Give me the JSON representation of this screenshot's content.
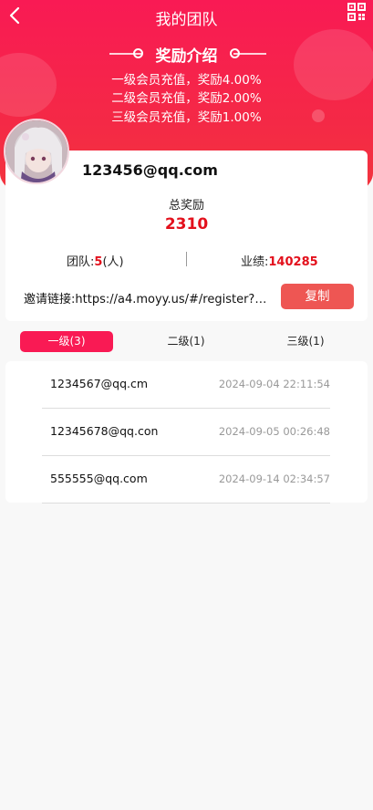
{
  "header": {
    "title": "我的团队"
  },
  "icons": {
    "back": "back-arrow-icon",
    "qr": "qr-code-icon"
  },
  "reward": {
    "heading": "奖励介绍",
    "lines": [
      "一级会员充值，奖励4.00%",
      "二级会员充值，奖励2.00%",
      "三级会员充值，奖励1.00%"
    ]
  },
  "profile": {
    "email": "123456@qq.com",
    "total_label": "总奖励",
    "total_value": "2310",
    "team_label": "团队:",
    "team_count": "5",
    "team_unit": "(人)",
    "perf_label": "业绩:",
    "perf_value": "140285",
    "invite_text": "邀请链接:https://a4.moyy.us/#/register?m=...",
    "copy_label": "复制"
  },
  "tabs": [
    {
      "label": "一级(3)",
      "active": true
    },
    {
      "label": "二级(1)",
      "active": false
    },
    {
      "label": "三级(1)",
      "active": false
    }
  ],
  "members": [
    {
      "email": "1234567@qq.cm",
      "time": "2024-09-04 22:11:54"
    },
    {
      "email": "12345678@qq.con",
      "time": "2024-09-05 00:26:48"
    },
    {
      "email": "555555@qq.com",
      "time": "2024-09-14 02:34:57"
    }
  ],
  "colors": {
    "brand": "#f91a54",
    "accent_red": "#e3101c",
    "copy_button": "#ee5653"
  }
}
